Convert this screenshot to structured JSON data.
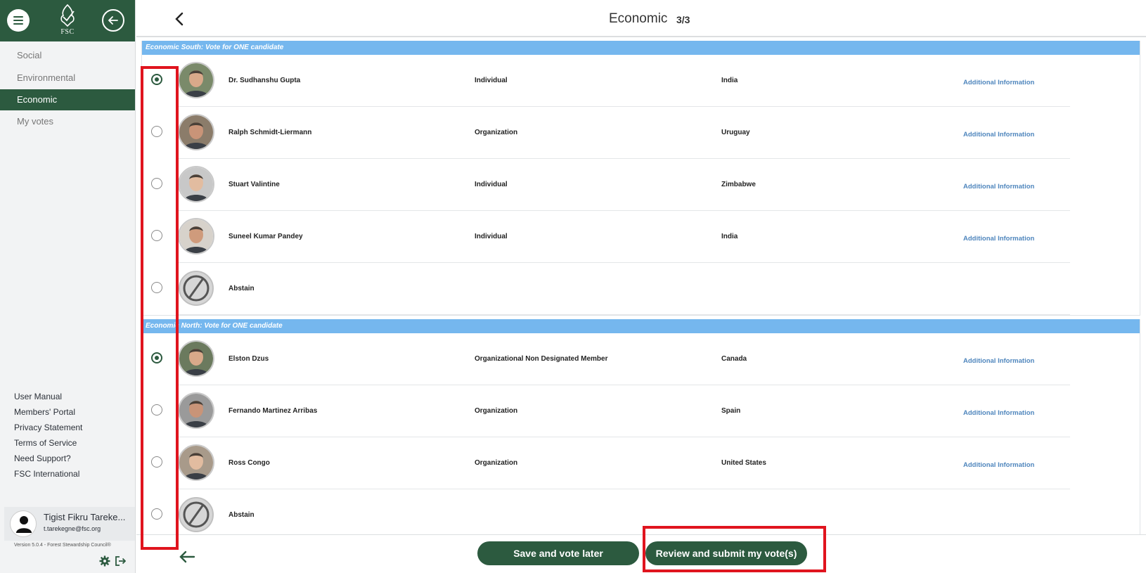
{
  "colors": {
    "brand_green": "#2c5a3f",
    "section_blue": "#75b7ee",
    "link_blue": "#4f86bd",
    "highlight_red": "#e0141e"
  },
  "sidebar": {
    "logo_text": "FSC",
    "nav": [
      {
        "label": "Social",
        "active": false
      },
      {
        "label": "Environmental",
        "active": false
      },
      {
        "label": "Economic",
        "active": true
      },
      {
        "label": "My votes",
        "active": false
      }
    ],
    "footer_links": [
      "User Manual",
      "Members' Portal",
      "Privacy Statement",
      "Terms of Service",
      "Need Support?",
      "FSC International"
    ],
    "user": {
      "name": "Tigist Fikru Tareke...",
      "email": "t.tarekegne@fsc.org"
    },
    "version": "Version 5.0.4 - Forest Stewardship Council®"
  },
  "header": {
    "title": "Economic",
    "page": "3/3"
  },
  "sections": [
    {
      "title": "Economic South: Vote for ONE candidate",
      "candidates": [
        {
          "name": "Dr. Sudhanshu Gupta",
          "type": "Individual",
          "country": "India",
          "link": "Additional Information",
          "selected": true,
          "abstain": false
        },
        {
          "name": "Ralph Schmidt-Liermann",
          "type": "Organization",
          "country": "Uruguay",
          "link": "Additional Information",
          "selected": false,
          "abstain": false
        },
        {
          "name": "Stuart Valintine",
          "type": "Individual",
          "country": "Zimbabwe",
          "link": "Additional Information",
          "selected": false,
          "abstain": false
        },
        {
          "name": "Suneel Kumar Pandey",
          "type": "Individual",
          "country": "India",
          "link": "Additional Information",
          "selected": false,
          "abstain": false
        },
        {
          "name": "Abstain",
          "type": "",
          "country": "",
          "link": "",
          "selected": false,
          "abstain": true
        }
      ]
    },
    {
      "title": "Economic North: Vote for ONE candidate",
      "candidates": [
        {
          "name": "Elston Dzus",
          "type": "Organizational Non Designated Member",
          "country": "Canada",
          "link": "Additional Information",
          "selected": true,
          "abstain": false
        },
        {
          "name": "Fernando Martinez Arribas",
          "type": "Organization",
          "country": "Spain",
          "link": "Additional Information",
          "selected": false,
          "abstain": false
        },
        {
          "name": "Ross Congo",
          "type": "Organization",
          "country": "United States",
          "link": "Additional Information",
          "selected": false,
          "abstain": false
        },
        {
          "name": "Abstain",
          "type": "",
          "country": "",
          "link": "",
          "selected": false,
          "abstain": true
        }
      ]
    }
  ],
  "actions": {
    "save_label": "Save and vote later",
    "submit_label": "Review and submit my vote(s)"
  }
}
